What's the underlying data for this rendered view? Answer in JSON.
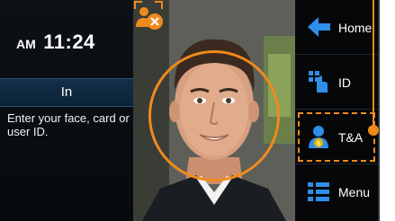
{
  "status_panel": {
    "ampm": "AM",
    "time": "11:24",
    "mode": "In",
    "prompt": "Enter your face, card or user ID."
  },
  "menu": {
    "items": [
      {
        "label": "Home",
        "icon": "arrow-left-icon"
      },
      {
        "label": "ID",
        "icon": "keypad-hand-icon"
      },
      {
        "label": "T&A",
        "icon": "user-money-icon"
      },
      {
        "label": "Menu",
        "icon": "list-icon"
      }
    ],
    "highlighted_item": "T&A"
  },
  "colors": {
    "accent": "#f08a1c",
    "menu_icon_blue": "#2f8fe8",
    "status_band": "#123048"
  }
}
